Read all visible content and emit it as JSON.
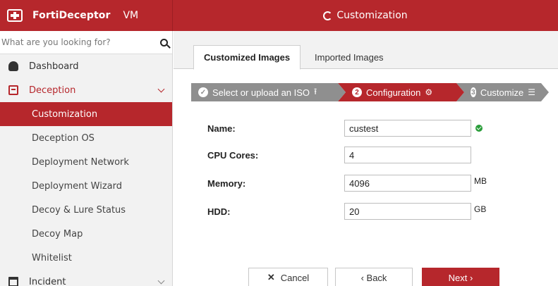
{
  "app": {
    "brand": "FortiDeceptor",
    "variant": "VM"
  },
  "header": {
    "title": "Customization"
  },
  "search": {
    "placeholder": "What are you looking for?"
  },
  "sidebar": {
    "dashboard": "Dashboard",
    "deception": "Deception",
    "sub_items": [
      "Customization",
      "Deception OS",
      "Deployment Network",
      "Deployment Wizard",
      "Decoy & Lure Status",
      "Decoy Map",
      "Whitelist"
    ],
    "incident": "Incident"
  },
  "tabs": [
    "Customized Images",
    "Imported Images"
  ],
  "steps": [
    {
      "num": "",
      "label": "Select or upload an ISO"
    },
    {
      "num": "2",
      "label": "Configuration"
    },
    {
      "num": "3",
      "label": "Customize"
    }
  ],
  "form": {
    "name_label": "Name:",
    "name_value": "custest",
    "cpu_label": "CPU Cores:",
    "cpu_value": "4",
    "memory_label": "Memory:",
    "memory_value": "4096",
    "memory_unit": "MB",
    "hdd_label": "HDD:",
    "hdd_value": "20",
    "hdd_unit": "GB"
  },
  "buttons": {
    "cancel": "Cancel",
    "back": "‹ Back",
    "next": "Next ›"
  },
  "colors": {
    "accent": "#b6272c",
    "step_inactive": "#8f8f8f",
    "valid": "#2a9d3a"
  }
}
